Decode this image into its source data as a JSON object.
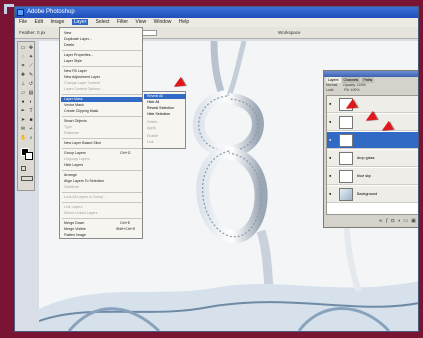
{
  "window": {
    "title": "Adobe Photoshop"
  },
  "menubar": {
    "items": [
      {
        "label": "File"
      },
      {
        "label": "Edit"
      },
      {
        "label": "Image"
      },
      {
        "label": "Layer"
      },
      {
        "label": "Select"
      },
      {
        "label": "Filter"
      },
      {
        "label": "View"
      },
      {
        "label": "Window"
      },
      {
        "label": "Help"
      }
    ]
  },
  "options_bar": {
    "label": "Feather: 0 px",
    "style_label": "Workspace"
  },
  "layer_menu": {
    "items": [
      {
        "label": "New"
      },
      {
        "label": "Duplicate Layer..."
      },
      {
        "label": "Delete"
      },
      {
        "label": "Layer Properties..."
      },
      {
        "label": "Layer Style"
      },
      {
        "label": "New Fill Layer"
      },
      {
        "label": "New Adjustment Layer"
      },
      {
        "label": "Change Layer Content"
      },
      {
        "label": "Layer Content Options..."
      },
      {
        "label": "Layer Mask"
      },
      {
        "label": "Vector Mask"
      },
      {
        "label": "Create Clipping Mask"
      },
      {
        "label": "Smart Objects"
      },
      {
        "label": "Type"
      },
      {
        "label": "Rasterize"
      },
      {
        "label": "New Layer Based Slice"
      },
      {
        "label": "Group Layers"
      },
      {
        "label": "Ungroup Layers"
      },
      {
        "label": "Hide Layers"
      },
      {
        "label": "Arrange"
      },
      {
        "label": "Align Layers To Selection"
      },
      {
        "label": "Distribute"
      },
      {
        "label": "Lock All Layers in Group..."
      },
      {
        "label": "Link Layers"
      },
      {
        "label": "Select Linked Layers"
      },
      {
        "label": "Merge Down"
      },
      {
        "label": "Merge Visible"
      },
      {
        "label": "Flatten Image"
      },
      {
        "label": "Matting"
      }
    ],
    "shortcuts": {
      "group": "Ctrl+G",
      "merge_down": "Ctrl+E",
      "merge_visible": "Shift+Ctrl+E"
    }
  },
  "submenu": {
    "items": [
      {
        "label": "Reveal All"
      },
      {
        "label": "Hide All"
      },
      {
        "label": "Reveal Selection"
      },
      {
        "label": "Hide Selection"
      },
      {
        "label": "Delete"
      },
      {
        "label": "Apply"
      },
      {
        "label": "Enable"
      },
      {
        "label": "Link"
      }
    ]
  },
  "layers_panel": {
    "tabs": [
      {
        "label": "Layers"
      },
      {
        "label": "Channels"
      },
      {
        "label": "Paths"
      }
    ],
    "blend_mode": "Normal",
    "opacity_label": "Opacity: 100%",
    "lock_label": "Lock:",
    "fill_label": "Fill: 100%",
    "layers": [
      {
        "name": ""
      },
      {
        "name": ""
      },
      {
        "name": ""
      },
      {
        "name": "drop glass"
      },
      {
        "name": "blue sky"
      },
      {
        "name": "Background"
      }
    ],
    "footer_icons": [
      "link-icon",
      "fx-icon",
      "mask-icon",
      "adjustment-icon",
      "folder-icon",
      "new-layer-icon",
      "trash-icon"
    ]
  },
  "colors": {
    "accent": "#316ac5",
    "frame": "#7a1434",
    "arrow": "#e0181a"
  }
}
